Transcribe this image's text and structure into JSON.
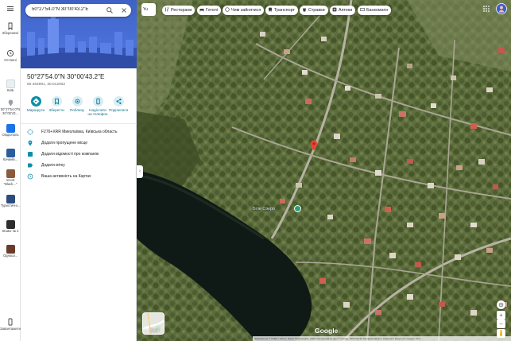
{
  "search": {
    "query": "50°27'54.0\"N 30°00'43.2\"E"
  },
  "rail": {
    "saved": "Збережені",
    "recent": "Останні",
    "items": [
      {
        "label": "Київ",
        "color": "#cfd8dc"
      },
      {
        "label": "50°27'54.0\"N 30°00'43...",
        "color": "#e8eaed"
      },
      {
        "label": "Овідіополь",
        "color": "#1a73e8"
      },
      {
        "label": "Качанів...",
        "color": "#2b5c9e"
      },
      {
        "label": "resort \"Black...\"",
        "color": "#8a5a3c"
      },
      {
        "label": "Туристичні...",
        "color": "#2b4c7e"
      },
      {
        "label": "Studio № 2",
        "color": "#2d2d2d"
      },
      {
        "label": "Одноші...",
        "color": "#6a3a2a"
      }
    ],
    "download": "Завантажити..."
  },
  "place": {
    "title": "50°27'54.0\"N 30°00'43.2\"E",
    "subtitle": "50.464991, 30.012002"
  },
  "actions": [
    {
      "label": "Маршрути",
      "icon": "directions-icon",
      "primary": true
    },
    {
      "label": "Зберегти",
      "icon": "bookmark-icon",
      "primary": false
    },
    {
      "label": "Поблизу",
      "icon": "nearby-icon",
      "primary": false
    },
    {
      "label": "Надіслати на телефон",
      "icon": "phone-icon",
      "primary": false
    },
    {
      "label": "Поділитися",
      "icon": "share-icon",
      "primary": false
    }
  ],
  "details": [
    {
      "icon": "plus-code-icon",
      "text": "F276+XRR Миколаївка, Київська область"
    },
    {
      "icon": "add-place-icon",
      "text": "Додати пропущене місце"
    },
    {
      "icon": "business-icon",
      "text": "Додати відомості про компанію"
    },
    {
      "icon": "label-icon",
      "text": "Додати мітку"
    },
    {
      "icon": "history-icon",
      "text": "Ваша активність на Картах"
    }
  ],
  "chips": [
    {
      "label": "Ресторани",
      "icon": "restaurant-icon"
    },
    {
      "label": "Готелі",
      "icon": "hotel-icon"
    },
    {
      "label": "Чим зайнятися",
      "icon": "things-icon"
    },
    {
      "label": "Транспорт",
      "icon": "transit-icon"
    },
    {
      "label": "Стравки",
      "icon": "takeout-icon"
    },
    {
      "label": "Аптеки",
      "icon": "pharmacy-icon"
    },
    {
      "label": "Банкомати",
      "icon": "atm-icon"
    }
  ],
  "map": {
    "lake_label": "Біле Озеро",
    "layers_label": "Шари",
    "brand": "Google",
    "attribution": "Зображення © CNES / Airbus, Maxar Technologies, 2025, Картографічні дані © Google, 2025   Умови   Конфіденційність   Надіслати відгук про продукт   20 м",
    "tools_label": "Yu"
  },
  "colors": {
    "accent": "#0b8fa8",
    "pin": "#ea4335"
  }
}
